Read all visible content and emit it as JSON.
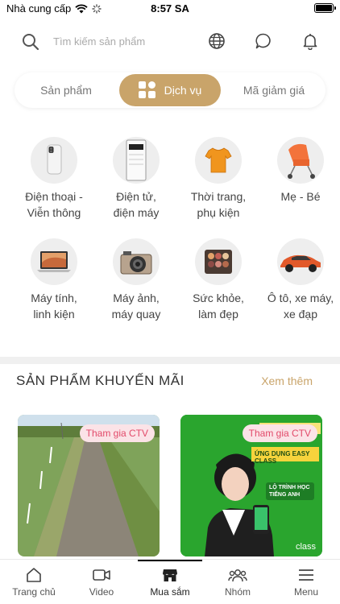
{
  "status": {
    "carrier": "Nhà cung cấp",
    "time": "8:57 SA"
  },
  "header": {
    "search_placeholder": "Tìm kiếm sản phẩm"
  },
  "tabs": [
    {
      "label": "Sản phẩm"
    },
    {
      "label": "Dịch vụ",
      "active": true
    },
    {
      "label": "Mã giảm giá"
    }
  ],
  "categories": [
    {
      "line1": "Điện thoại -",
      "line2": "Viễn thông",
      "icon": "phone-icon"
    },
    {
      "line1": "Điện tử,",
      "line2": "điện máy",
      "icon": "appliance-icon"
    },
    {
      "line1": "Thời trang,",
      "line2": "phụ kiện",
      "icon": "tshirt-icon"
    },
    {
      "line1": "Mẹ - Bé",
      "line2": "",
      "icon": "stroller-icon"
    },
    {
      "line1": "Máy tính,",
      "line2": "linh kiện",
      "icon": "laptop-icon"
    },
    {
      "line1": "Máy ảnh,",
      "line2": "máy quay",
      "icon": "camera-icon"
    },
    {
      "line1": "Sức khỏe,",
      "line2": "làm đẹp",
      "icon": "palette-icon"
    },
    {
      "line1": "Ô tô, xe máy,",
      "line2": "xe đạp",
      "icon": "car-icon"
    }
  ],
  "promo": {
    "title": "SẢN PHẨM KHUYẾN MÃI",
    "see_more": "Xem thêm",
    "cards": [
      {
        "badge": "Tham gia CTV"
      },
      {
        "badge": "Tham gia CTV",
        "banner": "ỨNG DỤNG EASY CLASS",
        "sub": "LỘ TRÌNH HỌC TIẾNG ANH"
      }
    ]
  },
  "nav": [
    {
      "label": "Trang chủ",
      "icon": "home-icon"
    },
    {
      "label": "Video",
      "icon": "video-icon"
    },
    {
      "label": "Mua sắm",
      "icon": "store-icon",
      "active": true
    },
    {
      "label": "Nhóm",
      "icon": "group-icon"
    },
    {
      "label": "Menu",
      "icon": "menu-icon"
    }
  ],
  "colors": {
    "accent": "#c9a46a",
    "badge_text": "#e24a6a",
    "badge_bg": "#fbe3e7",
    "promo_green": "#2aa52e"
  }
}
